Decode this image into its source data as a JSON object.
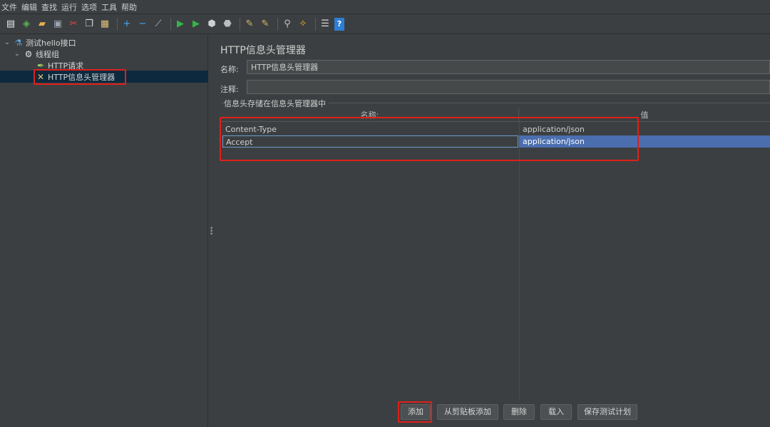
{
  "menu": [
    "文件",
    "编辑",
    "查找",
    "运行",
    "选项",
    "工具",
    "帮助"
  ],
  "toolbar": {
    "icons": [
      {
        "name": "new-icon",
        "glyph": "▤",
        "color": "#e8e8e8"
      },
      {
        "name": "templates-icon",
        "glyph": "◈",
        "color": "#5fb34f"
      },
      {
        "name": "open-icon",
        "glyph": "▰",
        "color": "#e8b04a"
      },
      {
        "name": "save-icon",
        "glyph": "▣",
        "color": "#9aa7b4"
      },
      {
        "name": "cut-icon",
        "glyph": "✂",
        "color": "#e64a3f"
      },
      {
        "name": "copy-icon",
        "glyph": "❐",
        "color": "#d8d8d8"
      },
      {
        "name": "paste-icon",
        "glyph": "▦",
        "color": "#e0c07a"
      },
      {
        "name": "expand-icon",
        "glyph": "+",
        "color": "#3fa9f5"
      },
      {
        "name": "collapse-icon",
        "glyph": "−",
        "color": "#3fa9f5"
      },
      {
        "name": "toggle-icon",
        "glyph": "⟋",
        "color": "#b0c4d8"
      },
      {
        "name": "start-icon",
        "glyph": "▶",
        "color": "#33b64a"
      },
      {
        "name": "start-no-pause-icon",
        "glyph": "▶",
        "color": "#33b64a"
      },
      {
        "name": "stop-icon",
        "glyph": "⬢",
        "color": "#cfcfcf"
      },
      {
        "name": "shutdown-icon",
        "glyph": "⬣",
        "color": "#bdbdbd"
      },
      {
        "name": "clear-icon",
        "glyph": "✎",
        "color": "#d7b56b"
      },
      {
        "name": "clear-all-icon",
        "glyph": "✎",
        "color": "#d7b56b"
      },
      {
        "name": "search-icon",
        "glyph": "⚲",
        "color": "#c0c0c0"
      },
      {
        "name": "reset-search-icon",
        "glyph": "✧",
        "color": "#f0b429"
      },
      {
        "name": "function-helper-icon",
        "glyph": "☰",
        "color": "#d8d8d8"
      },
      {
        "name": "help-icon",
        "glyph": "?",
        "color": "#2d7fd6"
      }
    ]
  },
  "tree": {
    "root": "测试hello接口",
    "thread_group": "线程组",
    "http_request": "HTTP请求",
    "header_manager": "HTTP信息头管理器"
  },
  "panel": {
    "title": "HTTP信息头管理器",
    "name_label": "名称:",
    "name_value": "HTTP信息头管理器",
    "comment_label": "注释:",
    "comment_value": "",
    "group_title": "信息头存储在信息头管理器中"
  },
  "table": {
    "headers": [
      "名称:",
      "值"
    ],
    "rows": [
      {
        "name": "Content-Type",
        "value": "application/json"
      },
      {
        "name": "Accept",
        "value": "application/json"
      }
    ]
  },
  "buttons": {
    "add": "添加",
    "add_from_clipboard": "从剪贴板添加",
    "delete": "删除",
    "load": "载入",
    "save_test_plan": "保存测试计划"
  },
  "colors": {
    "highlight": "#e0201a",
    "selection": "#4b6eaf",
    "background": "#3c3f41"
  }
}
